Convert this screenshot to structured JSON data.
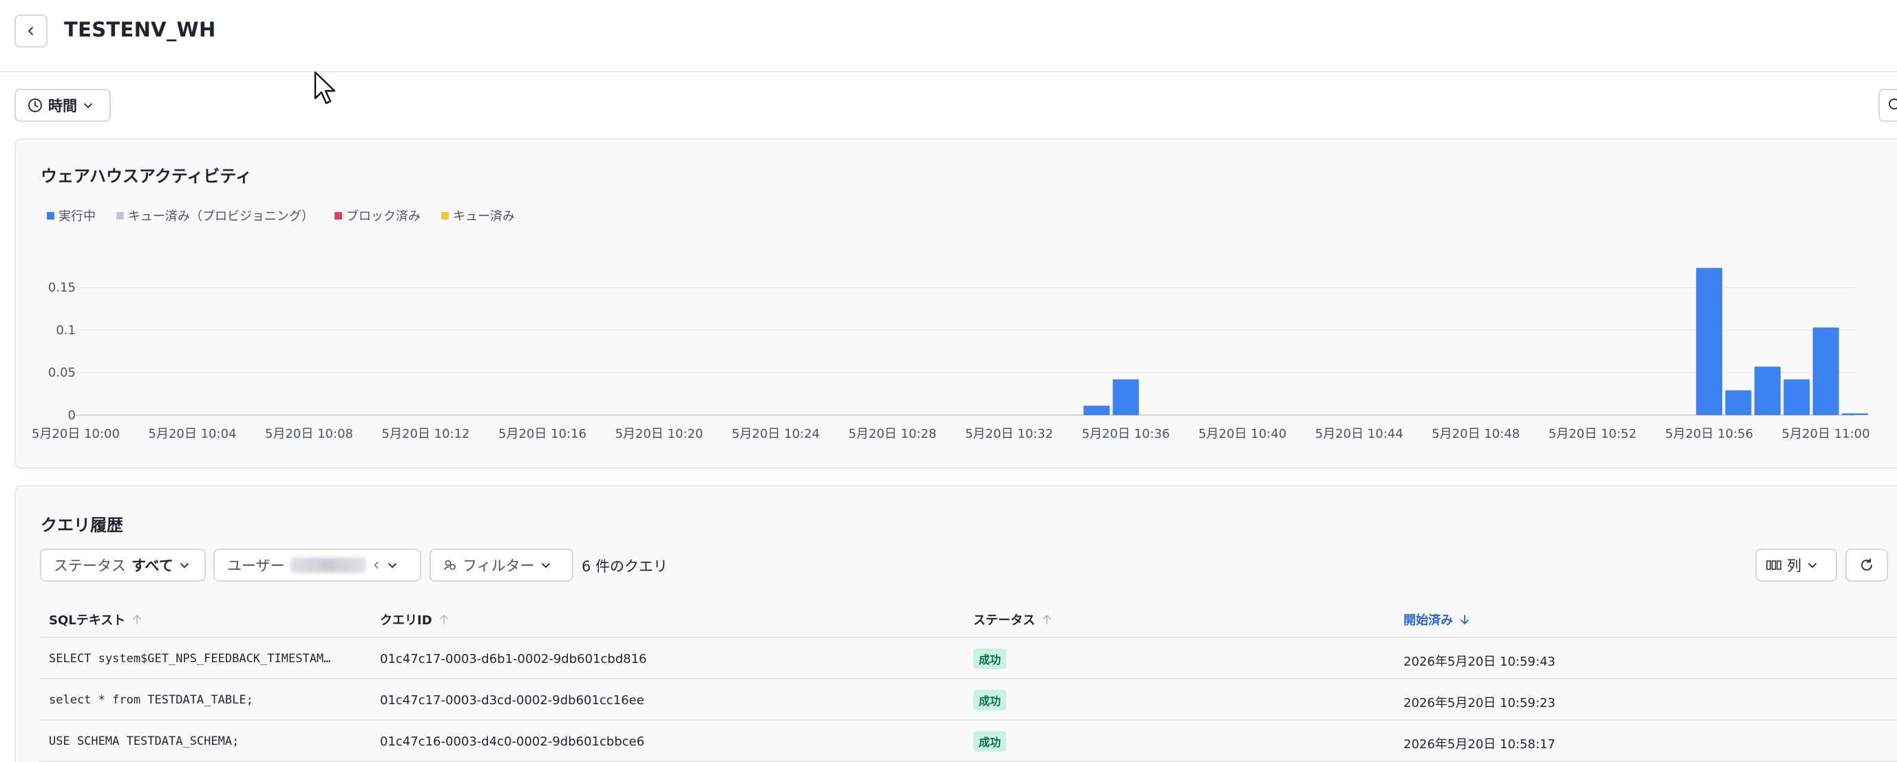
{
  "header": {
    "title": "TESTENV_WH"
  },
  "toolbar": {
    "time_label": "時間"
  },
  "activity": {
    "title": "ウェアハウスアクティビティ",
    "legend": [
      {
        "label": "実行中",
        "color": "#3b82f0"
      },
      {
        "label": "キュー済み（プロビジョニング）",
        "color": "#c2c5d6"
      },
      {
        "label": "ブロック済み",
        "color": "#e0405e"
      },
      {
        "label": "キュー済み",
        "color": "#f3c53a"
      }
    ]
  },
  "chart_data": {
    "type": "bar",
    "x_tick_labels": [
      "5月20日 10:00",
      "5月20日 10:04",
      "5月20日 10:08",
      "5月20日 10:12",
      "5月20日 10:16",
      "5月20日 10:20",
      "5月20日 10:24",
      "5月20日 10:28",
      "5月20日 10:32",
      "5月20日 10:36",
      "5月20日 10:40",
      "5月20日 10:44",
      "5月20日 10:48",
      "5月20日 10:52",
      "5月20日 10:56",
      "5月20日 11:00"
    ],
    "y_tick_labels": [
      "0",
      "0.05",
      "0.1",
      "0.15"
    ],
    "ylim": [
      0,
      0.17
    ],
    "series": [
      {
        "name": "実行中",
        "color": "#3b82f0",
        "x_minutes_after_1000": [
          35,
          36,
          56,
          57,
          58,
          59,
          60,
          61
        ],
        "values": [
          0.011,
          0.042,
          0.173,
          0.029,
          0.057,
          0.042,
          0.103,
          0.002
        ]
      }
    ]
  },
  "history": {
    "title": "クエリ履歴",
    "status_prefix": "ステータス",
    "status_value": "すべて",
    "user_prefix": "ユーザー",
    "filter_label": "フィルター",
    "count_text": "6 件のクエリ",
    "columns_label": "列",
    "headers": {
      "sql": "SQLテキスト",
      "query_id": "クエリID",
      "status": "ステータス",
      "started": "開始済み"
    },
    "rows": [
      {
        "sql": "SELECT system$GET_NPS_FEEDBACK_TIMESTAM…",
        "query_id": "01c47c17-0003-d6b1-0002-9db601cbd816",
        "status": "成功",
        "started": "2026年5月20日 10:59:43"
      },
      {
        "sql": "select * from TESTDATA_TABLE;",
        "query_id": "01c47c17-0003-d3cd-0002-9db601cc16ee",
        "status": "成功",
        "started": "2026年5月20日 10:59:23"
      },
      {
        "sql": "USE SCHEMA TESTDATA_SCHEMA;",
        "query_id": "01c47c16-0003-d4c0-0002-9db601cbbce6",
        "status": "成功",
        "started": "2026年5月20日 10:58:17"
      }
    ]
  }
}
